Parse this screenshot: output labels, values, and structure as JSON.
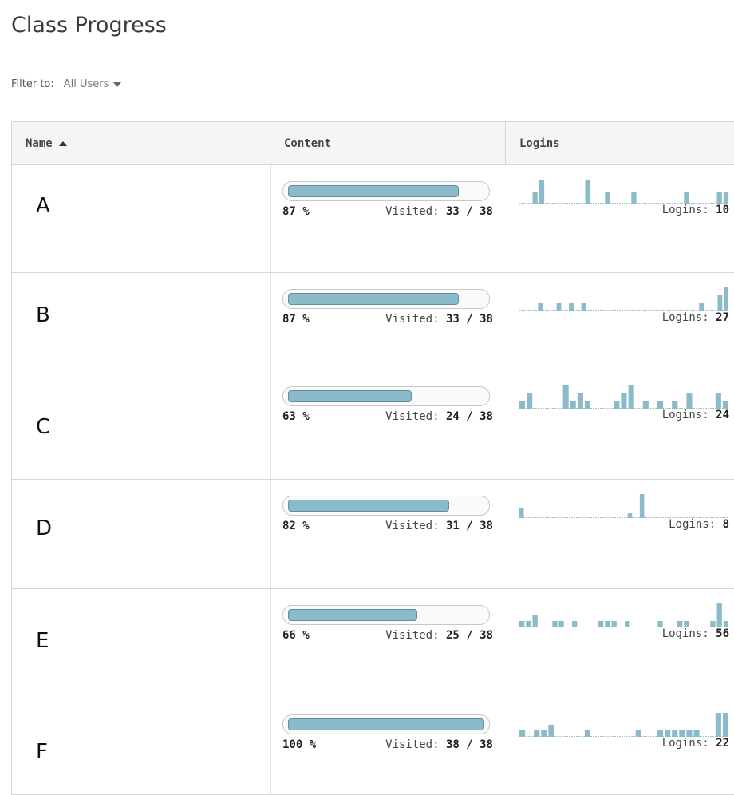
{
  "page": {
    "title": "Class Progress"
  },
  "filter": {
    "label": "Filter to:",
    "value": "All Users"
  },
  "table": {
    "headers": {
      "name": "Name",
      "content": "Content",
      "logins": "Logins"
    }
  },
  "rows": [
    {
      "name": "A",
      "percent_text": "87 %",
      "percent": 87,
      "visited_label": "Visited:",
      "visited": "33 / 38",
      "logins_label": "Logins:",
      "logins": "10",
      "spark": [
        0,
        0,
        1,
        2,
        0,
        0,
        0,
        0,
        0,
        0,
        2,
        0,
        0,
        1,
        0,
        0,
        0,
        1,
        0,
        0,
        0,
        0,
        0,
        0,
        0,
        1,
        0,
        0,
        0,
        0,
        1,
        1
      ]
    },
    {
      "name": "B",
      "percent_text": "87 %",
      "percent": 87,
      "visited_label": "Visited:",
      "visited": "33 / 38",
      "logins_label": "Logins:",
      "logins": "27",
      "spark": [
        0,
        0,
        0,
        1,
        0,
        0,
        1,
        0,
        1,
        0,
        1,
        0,
        0,
        0,
        0,
        0,
        0,
        0,
        0,
        0,
        0,
        0,
        0,
        0,
        0,
        0,
        0,
        0,
        0,
        1,
        0,
        0,
        2,
        3
      ]
    },
    {
      "name": "C",
      "percent_text": "63 %",
      "percent": 63,
      "visited_label": "Visited:",
      "visited": "24 / 38",
      "logins_label": "Logins:",
      "logins": "24",
      "spark": [
        1,
        2,
        0,
        0,
        0,
        0,
        3,
        1,
        2,
        1,
        0,
        0,
        0,
        1,
        2,
        3,
        0,
        1,
        0,
        1,
        0,
        1,
        0,
        2,
        0,
        0,
        0,
        2,
        1
      ]
    },
    {
      "name": "D",
      "percent_text": "82 %",
      "percent": 82,
      "visited_label": "Visited:",
      "visited": "31 / 38",
      "logins_label": "Logins:",
      "logins": "8",
      "spark": [
        2,
        0,
        0,
        0,
        0,
        0,
        0,
        0,
        0,
        0,
        0,
        0,
        0,
        0,
        0,
        0,
        0,
        0,
        1,
        0,
        5,
        0,
        0,
        0,
        0,
        0,
        0,
        0,
        0,
        0,
        0,
        0,
        0,
        0,
        0
      ]
    },
    {
      "name": "E",
      "percent_text": "66 %",
      "percent": 66,
      "visited_label": "Visited:",
      "visited": "25 / 38",
      "logins_label": "Logins:",
      "logins": "56",
      "spark": [
        1,
        1,
        2,
        0,
        0,
        1,
        1,
        0,
        1,
        0,
        0,
        0,
        1,
        1,
        1,
        0,
        1,
        0,
        0,
        0,
        0,
        1,
        0,
        0,
        1,
        1,
        0,
        0,
        0,
        1,
        4,
        1
      ]
    },
    {
      "name": "F",
      "percent_text": "100 %",
      "percent": 100,
      "visited_label": "Visited:",
      "visited": "38 / 38",
      "logins_label": "Logins:",
      "logins": "22",
      "spark": [
        1,
        0,
        1,
        1,
        2,
        0,
        0,
        0,
        0,
        1,
        0,
        0,
        0,
        0,
        0,
        0,
        1,
        0,
        0,
        1,
        1,
        1,
        1,
        1,
        1,
        0,
        0,
        4,
        4
      ]
    }
  ],
  "colors": {
    "bar_fill": "#8bbac8",
    "bar_border": "#5f8e9c",
    "spark": "#8bbac8",
    "baseline": "#9fc6d2"
  }
}
